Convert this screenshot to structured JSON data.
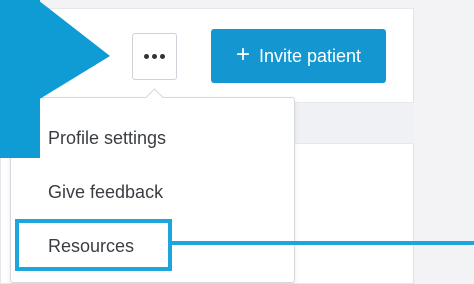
{
  "header": {
    "more_actions_icon": "more-horizontal-icon",
    "invite_button": {
      "icon": "plus-icon",
      "icon_glyph": "+",
      "label": "Invite patient",
      "color": "#1497d1"
    }
  },
  "menu": {
    "items": [
      {
        "label": "Profile settings"
      },
      {
        "label": "Give feedback"
      },
      {
        "label": "Resources"
      }
    ]
  },
  "annotation": {
    "color": "#1ca6db"
  }
}
